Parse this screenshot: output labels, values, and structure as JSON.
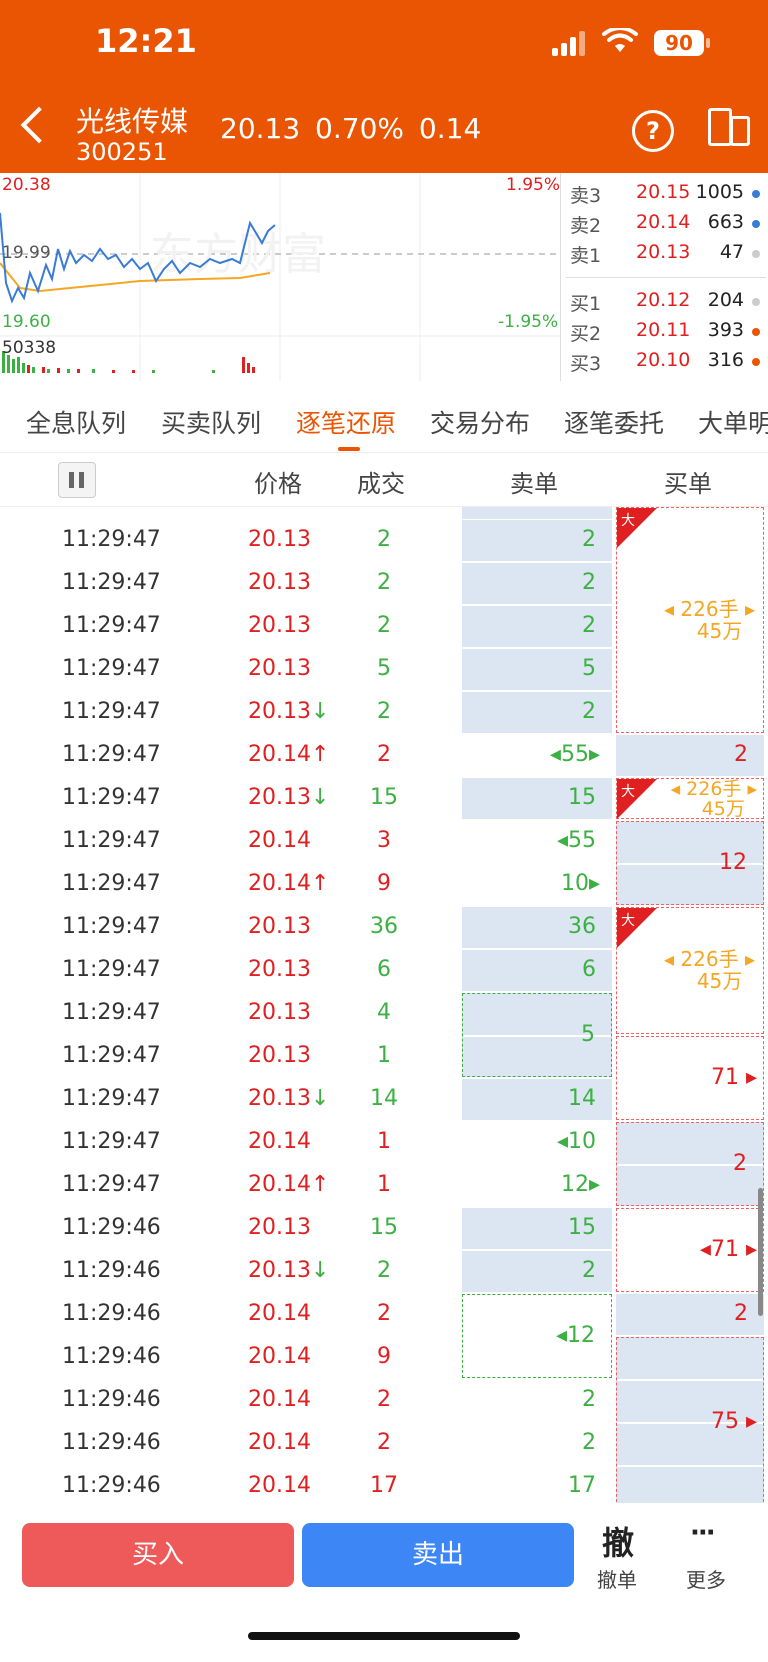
{
  "status": {
    "time": "12:21",
    "battery": "90"
  },
  "header": {
    "name": "光线传媒",
    "code": "300251",
    "quote": "20.13  0.70%  0.14",
    "help_label": "?"
  },
  "chart": {
    "high": "20.38",
    "mid": "19.99",
    "low": "19.60",
    "pct_up": "1.95%",
    "pct_down": "-1.95%",
    "volume": "50338"
  },
  "orderbook": [
    {
      "label": "卖3",
      "price": "20.15",
      "vol": "1005",
      "dot": "#3A7BD5"
    },
    {
      "label": "卖2",
      "price": "20.14",
      "vol": "663",
      "dot": "#3A7BD5"
    },
    {
      "label": "卖1",
      "price": "20.13",
      "vol": "47",
      "dot": "#cccccc"
    },
    {
      "label": "买1",
      "price": "20.12",
      "vol": "204",
      "dot": "#cccccc"
    },
    {
      "label": "买2",
      "price": "20.11",
      "vol": "393",
      "dot": "#EA5504"
    },
    {
      "label": "买3",
      "price": "20.10",
      "vol": "316",
      "dot": "#EA5504"
    }
  ],
  "tabs": [
    "全息队列",
    "买卖队列",
    "逐笔还原",
    "交易分布",
    "逐笔委托",
    "大单明"
  ],
  "columns": {
    "price": "价格",
    "volume": "成交",
    "sell": "卖单",
    "buy": "买单"
  },
  "rows": [
    {
      "time": "11:29:47",
      "price": "20.13",
      "arrow": "",
      "vol": "2"
    },
    {
      "time": "11:29:47",
      "price": "20.13",
      "arrow": "",
      "vol": "2"
    },
    {
      "time": "11:29:47",
      "price": "20.13",
      "arrow": "",
      "vol": "2"
    },
    {
      "time": "11:29:47",
      "price": "20.13",
      "arrow": "",
      "vol": "5"
    },
    {
      "time": "11:29:47",
      "price": "20.13",
      "arrow": "↓",
      "vol": "2"
    },
    {
      "time": "11:29:47",
      "price": "20.14",
      "arrow": "↑",
      "vol": "2"
    },
    {
      "time": "11:29:47",
      "price": "20.13",
      "arrow": "↓",
      "vol": "15"
    },
    {
      "time": "11:29:47",
      "price": "20.14",
      "arrow": "",
      "vol": "3"
    },
    {
      "time": "11:29:47",
      "price": "20.14",
      "arrow": "↑",
      "vol": "9"
    },
    {
      "time": "11:29:47",
      "price": "20.13",
      "arrow": "",
      "vol": "36"
    },
    {
      "time": "11:29:47",
      "price": "20.13",
      "arrow": "",
      "vol": "6"
    },
    {
      "time": "11:29:47",
      "price": "20.13",
      "arrow": "",
      "vol": "4"
    },
    {
      "time": "11:29:47",
      "price": "20.13",
      "arrow": "",
      "vol": "1"
    },
    {
      "time": "11:29:47",
      "price": "20.13",
      "arrow": "↓",
      "vol": "14"
    },
    {
      "time": "11:29:47",
      "price": "20.14",
      "arrow": "",
      "vol": "1"
    },
    {
      "time": "11:29:47",
      "price": "20.14",
      "arrow": "↑",
      "vol": "1"
    },
    {
      "time": "11:29:46",
      "price": "20.13",
      "arrow": "",
      "vol": "15"
    },
    {
      "time": "11:29:46",
      "price": "20.13",
      "arrow": "↓",
      "vol": "2"
    },
    {
      "time": "11:29:46",
      "price": "20.14",
      "arrow": "",
      "vol": "2"
    },
    {
      "time": "11:29:46",
      "price": "20.14",
      "arrow": "",
      "vol": "9"
    },
    {
      "time": "11:29:46",
      "price": "20.14",
      "arrow": "",
      "vol": "2"
    },
    {
      "time": "11:29:46",
      "price": "20.14",
      "arrow": "",
      "vol": "2"
    },
    {
      "time": "11:29:46",
      "price": "20.14",
      "arrow": "",
      "vol": "17"
    }
  ],
  "sell_cells": [
    "2",
    "2",
    "2",
    "5",
    "2",
    "55",
    "15",
    "55",
    "10",
    "36",
    "6",
    "5",
    "14",
    "10",
    "12",
    "15",
    "2",
    "12",
    "2",
    "2",
    "17"
  ],
  "buy_cells": {
    "big_label": "大",
    "big_amount_1": "226手",
    "big_amount_2": "45万",
    "b2": "2",
    "b12": "12",
    "b71": "71",
    "b2b": "2",
    "b71b": "71",
    "b2c": "2",
    "b75": "75"
  },
  "bottom": {
    "buy": "买入",
    "sell": "卖出",
    "cancel_icon": "撤",
    "cancel": "撤单",
    "more": "更多",
    "more_icon": "···"
  }
}
